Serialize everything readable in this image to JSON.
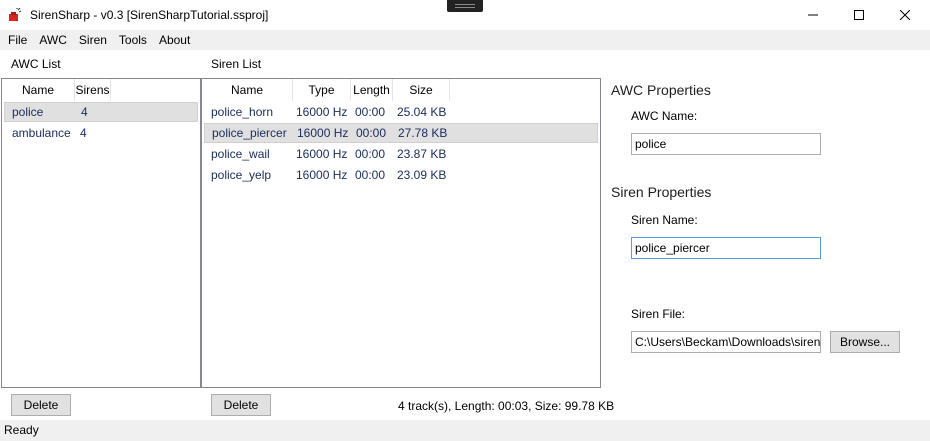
{
  "window": {
    "title": "SirenSharp - v0.3 [SirenSharpTutorial.ssproj]",
    "app_icon": "siren-app-icon",
    "controls": [
      "minimize-icon",
      "maximize-icon",
      "close-icon"
    ]
  },
  "menu": [
    "File",
    "AWC",
    "Siren",
    "Tools",
    "About"
  ],
  "awc_panel": {
    "label": "AWC List",
    "columns": [
      "Name",
      "Sirens"
    ],
    "rows": [
      {
        "name": "police",
        "sirens": "4",
        "selected": true
      },
      {
        "name": "ambulance",
        "sirens": "4",
        "selected": false
      }
    ],
    "delete_label": "Delete"
  },
  "siren_panel": {
    "label": "Siren List",
    "columns": [
      "Name",
      "Type",
      "Length",
      "Size"
    ],
    "rows": [
      {
        "name": "police_horn",
        "type": "16000 Hz",
        "length": "00:00",
        "size": "25.04 KB",
        "selected": false
      },
      {
        "name": "police_piercer",
        "type": "16000 Hz",
        "length": "00:00",
        "size": "27.78 KB",
        "selected": true
      },
      {
        "name": "police_wail",
        "type": "16000 Hz",
        "length": "00:00",
        "size": "23.87 KB",
        "selected": false
      },
      {
        "name": "police_yelp",
        "type": "16000 Hz",
        "length": "00:00",
        "size": "23.09 KB",
        "selected": false
      }
    ],
    "delete_label": "Delete",
    "summary": "4 track(s), Length: 00:03, Size: 99.78 KB"
  },
  "properties": {
    "awc_heading": "AWC Properties",
    "awc_name_label": "AWC Name:",
    "awc_name_value": "police",
    "siren_heading": "Siren Properties",
    "siren_name_label": "Siren Name:",
    "siren_name_value": "police_piercer",
    "siren_file_label": "Siren File:",
    "siren_file_value": "C:\\Users\\Beckam\\Downloads\\sirens",
    "browse_label": "Browse..."
  },
  "status": "Ready"
}
